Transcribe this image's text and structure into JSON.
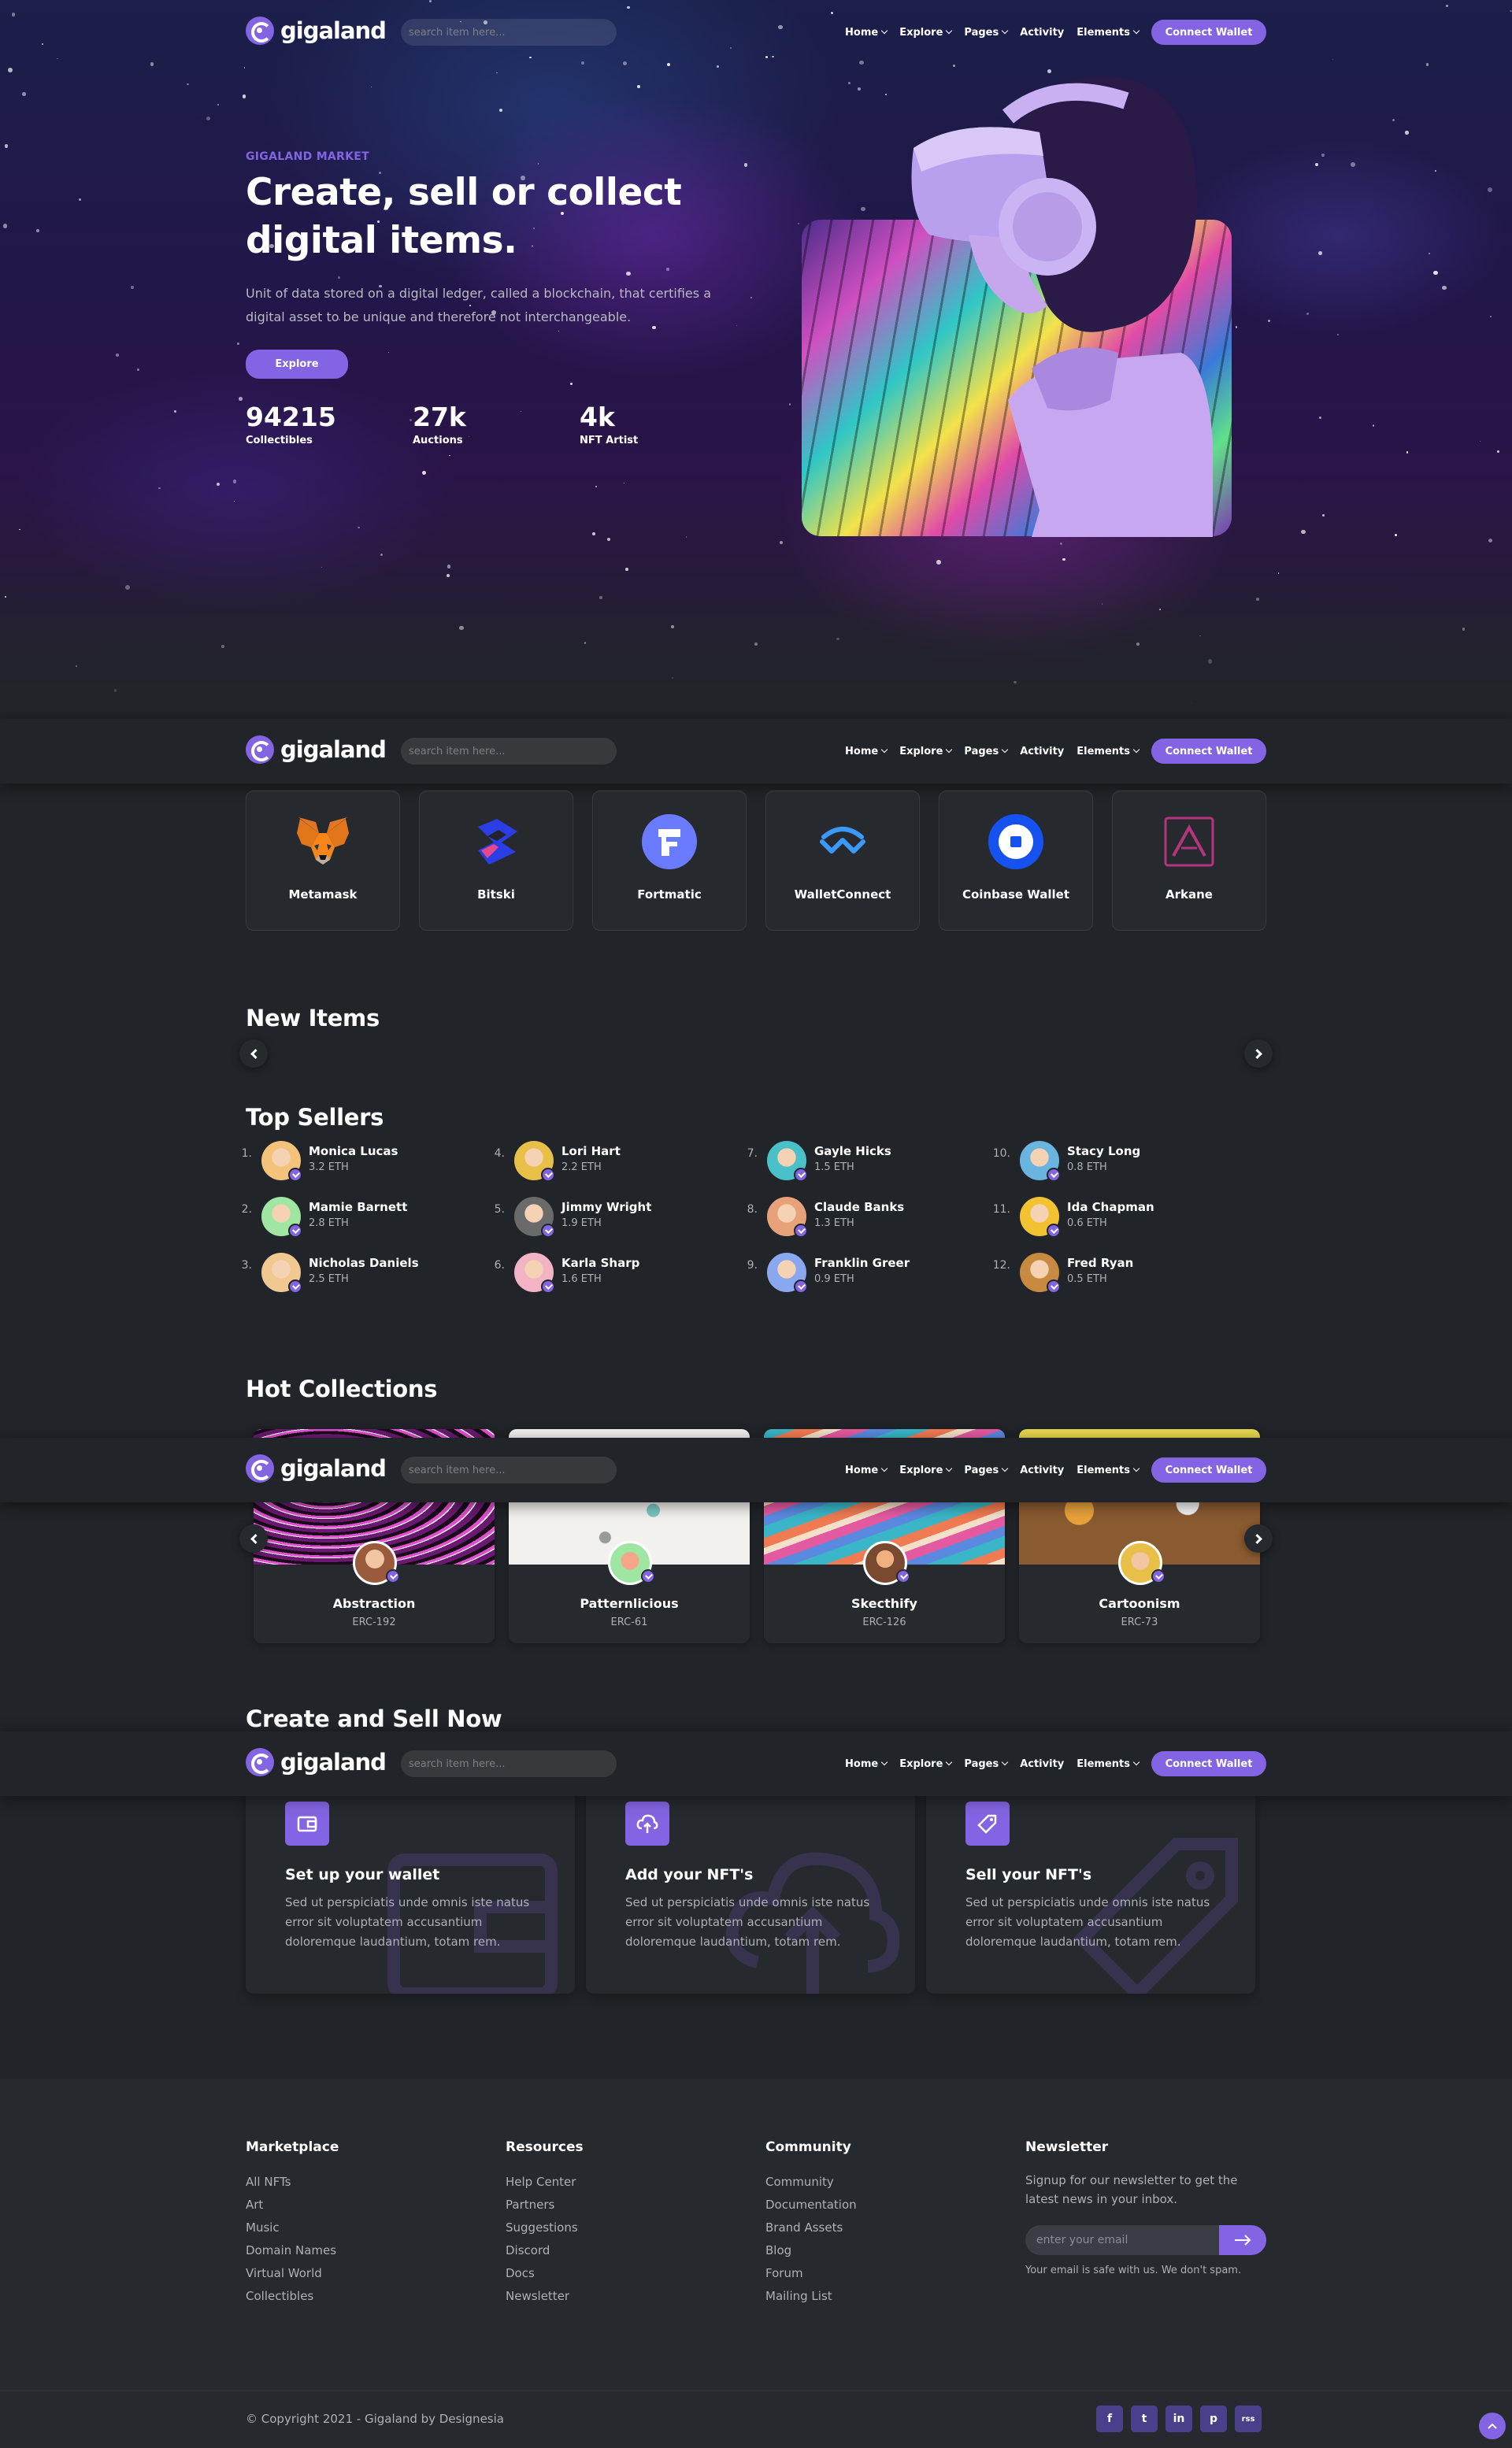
{
  "header": {
    "logo_text": "gigaland",
    "search_placeholder": "search item here...",
    "nav": [
      "Home",
      "Explore",
      "Pages",
      "Activity",
      "Elements"
    ],
    "connect_label": "Connect Wallet"
  },
  "hero": {
    "eyebrow": "GIGALAND MARKET",
    "title": "Create, sell or collect digital items.",
    "subtitle": "Unit of data stored on a digital ledger, called a blockchain, that certifies a digital asset to be unique and therefore not interchangeable.",
    "cta_label": "Explore",
    "stats": [
      {
        "value": "94215",
        "label": "Collectibles"
      },
      {
        "value": "27k",
        "label": "Auctions"
      },
      {
        "value": "4k",
        "label": "NFT Artist"
      }
    ]
  },
  "wallets": [
    "Metamask",
    "Bitski",
    "Fortmatic",
    "WalletConnect",
    "Coinbase Wallet",
    "Arkane"
  ],
  "new_items": {
    "title": "New Items"
  },
  "top_sellers": {
    "title": "Top Sellers",
    "items": [
      {
        "rank": "1.",
        "name": "Monica Lucas",
        "eth": "3.2 ETH"
      },
      {
        "rank": "2.",
        "name": "Mamie Barnett",
        "eth": "2.8 ETH"
      },
      {
        "rank": "3.",
        "name": "Nicholas Daniels",
        "eth": "2.5 ETH"
      },
      {
        "rank": "4.",
        "name": "Lori Hart",
        "eth": "2.2 ETH"
      },
      {
        "rank": "5.",
        "name": "Jimmy Wright",
        "eth": "1.9 ETH"
      },
      {
        "rank": "6.",
        "name": "Karla Sharp",
        "eth": "1.6 ETH"
      },
      {
        "rank": "7.",
        "name": "Gayle Hicks",
        "eth": "1.5 ETH"
      },
      {
        "rank": "8.",
        "name": "Claude Banks",
        "eth": "1.3 ETH"
      },
      {
        "rank": "9.",
        "name": "Franklin Greer",
        "eth": "0.9 ETH"
      },
      {
        "rank": "10.",
        "name": "Stacy Long",
        "eth": "0.8 ETH"
      },
      {
        "rank": "11.",
        "name": "Ida Chapman",
        "eth": "0.6 ETH"
      },
      {
        "rank": "12.",
        "name": "Fred Ryan",
        "eth": "0.5 ETH"
      }
    ]
  },
  "hot_collections": {
    "title": "Hot Collections",
    "items": [
      {
        "name": "Abstraction",
        "code": "ERC-192"
      },
      {
        "name": "Patternlicious",
        "code": "ERC-61"
      },
      {
        "name": "Skecthify",
        "code": "ERC-126"
      },
      {
        "name": "Cartoonism",
        "code": "ERC-73"
      }
    ]
  },
  "create_sell": {
    "title": "Create and Sell Now",
    "items": [
      {
        "title": "Set up your wallet",
        "icon": "wallet-icon",
        "text": "Sed ut perspiciatis unde omnis iste natus error sit voluptatem accusantium doloremque laudantium, totam rem."
      },
      {
        "title": "Add your NFT's",
        "icon": "cloud-upload-icon",
        "text": "Sed ut perspiciatis unde omnis iste natus error sit voluptatem accusantium doloremque laudantium, totam rem."
      },
      {
        "title": "Sell your NFT's",
        "icon": "tag-icon",
        "text": "Sed ut perspiciatis unde omnis iste natus error sit voluptatem accusantium doloremque laudantium, totam rem."
      }
    ]
  },
  "footer": {
    "marketplace": {
      "title": "Marketplace",
      "links": [
        "All NFTs",
        "Art",
        "Music",
        "Domain Names",
        "Virtual World",
        "Collectibles"
      ]
    },
    "resources": {
      "title": "Resources",
      "links": [
        "Help Center",
        "Partners",
        "Suggestions",
        "Discord",
        "Docs",
        "Newsletter"
      ]
    },
    "community": {
      "title": "Community",
      "links": [
        "Community",
        "Documentation",
        "Brand Assets",
        "Blog",
        "Forum",
        "Mailing List"
      ]
    },
    "newsletter": {
      "title": "Newsletter",
      "text": "Signup for our newsletter to get the latest news in your inbox.",
      "placeholder": "enter your email",
      "note": "Your email is safe with us. We don't spam."
    },
    "copyright": "© Copyright 2021 - Gigaland by Designesia",
    "social": [
      "f",
      "t",
      "in",
      "p",
      "rss"
    ]
  },
  "colors": {
    "accent": "#8364e2",
    "background": "#212428",
    "card": "#26292d"
  }
}
